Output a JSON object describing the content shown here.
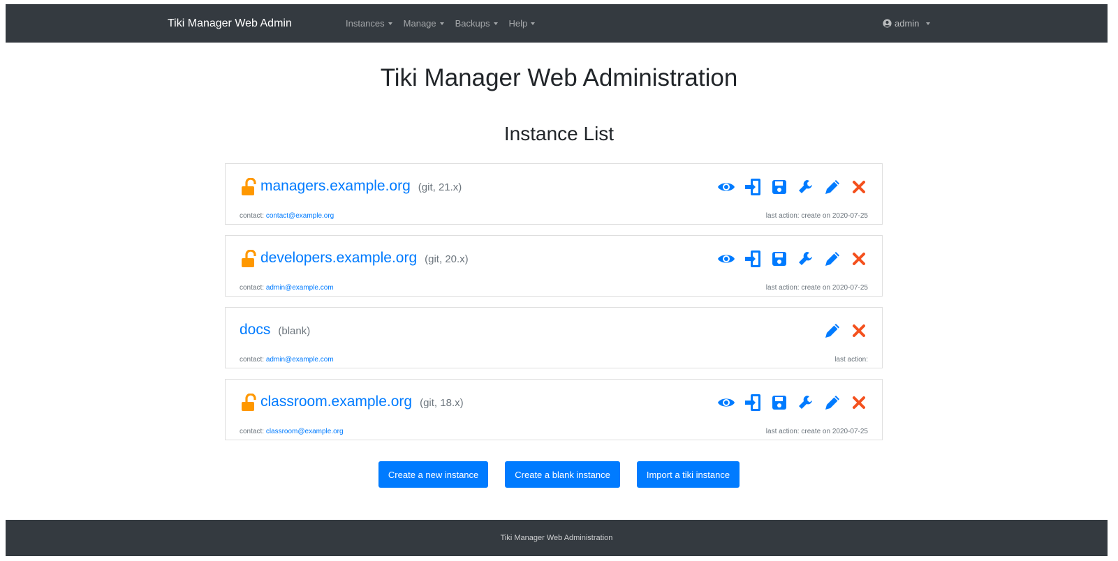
{
  "navbar": {
    "brand": "Tiki Manager Web Admin",
    "items": [
      {
        "label": "Instances"
      },
      {
        "label": "Manage"
      },
      {
        "label": "Backups"
      },
      {
        "label": "Help"
      }
    ],
    "user": "admin"
  },
  "page_title": "Tiki Manager Web Administration",
  "section_title": "Instance List",
  "instances": [
    {
      "name": "managers.example.org",
      "meta": "(git, 21.x)",
      "contact_label": "contact:",
      "contact": "contact@example.org",
      "last_action": "last action: create on 2020-07-25",
      "locked": true
    },
    {
      "name": "developers.example.org",
      "meta": "(git, 20.x)",
      "contact_label": "contact:",
      "contact": "admin@example.com",
      "last_action": "last action: create on 2020-07-25",
      "locked": true
    },
    {
      "name": "docs",
      "meta": "(blank)",
      "contact_label": "contact:",
      "contact": "admin@example.com",
      "last_action": "last action:",
      "locked": false
    },
    {
      "name": "classroom.example.org",
      "meta": "(git, 18.x)",
      "contact_label": "contact:",
      "contact": "classroom@example.org",
      "last_action": "last action: create on 2020-07-25",
      "locked": true
    }
  ],
  "buttons": {
    "create_new": "Create a new instance",
    "create_blank": "Create a blank instance",
    "import": "Import a tiki instance"
  },
  "footer": "Tiki Manager Web Administration",
  "colors": {
    "nav_bg": "#343a40",
    "primary": "#007bff",
    "lock": "#ff9800",
    "delete": "#f4511e"
  }
}
